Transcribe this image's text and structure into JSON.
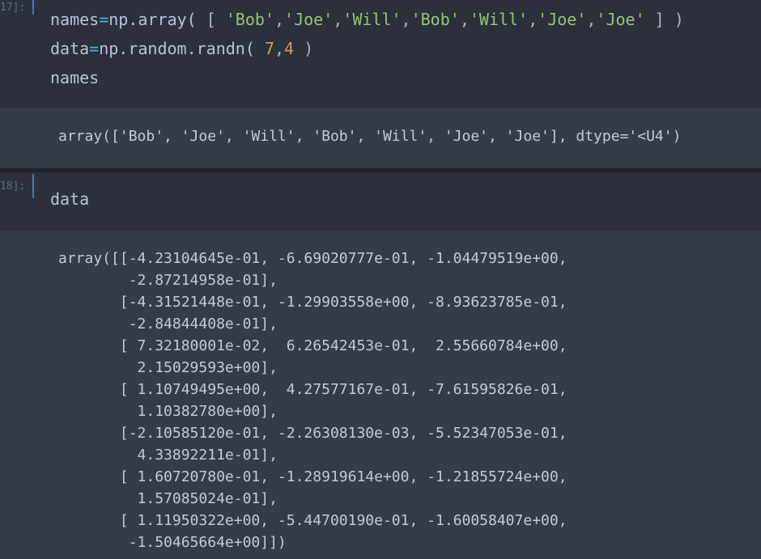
{
  "cells": [
    {
      "prompt": "17]:",
      "input": {
        "line1": {
          "var": "names",
          "op": "=",
          "call": "np.array(",
          "bracket_open": " [ ",
          "s1": "'Bob'",
          "c1": ",",
          "s2": "'Joe'",
          "c2": ",",
          "s3": "'Will'",
          "c3": ",",
          "s4": "'Bob'",
          "c4": ",",
          "s5": "'Will'",
          "c5": ",",
          "s6": "'Joe'",
          "c6": ",",
          "s7": "'Joe'",
          "bracket_close": " ] )"
        },
        "line2": {
          "var": "data",
          "op": "=",
          "call": "np.random.randn(",
          "n1": " 7",
          "comma": ",",
          "n2": "4",
          "close": " )"
        },
        "line3": "names"
      },
      "output": "array(['Bob', 'Joe', 'Will', 'Bob', 'Will', 'Joe', 'Joe'], dtype='<U4')"
    },
    {
      "prompt": "18]:",
      "input": {
        "line1": "data"
      },
      "output_lines": [
        "array([[-4.23104645e-01, -6.69020777e-01, -1.04479519e+00,",
        "        -2.87214958e-01],",
        "       [-4.31521448e-01, -1.29903558e+00, -8.93623785e-01,",
        "        -2.84844408e-01],",
        "       [ 7.32180001e-02,  6.26542453e-01,  2.55660784e+00,",
        "         2.15029593e+00],",
        "       [ 1.10749495e+00,  4.27577167e-01, -7.61595826e-01,",
        "         1.10382780e+00],",
        "       [-2.10585120e-01, -2.26308130e-03, -5.52347053e-01,",
        "         4.33892211e-01],",
        "       [ 1.60720780e-01, -1.28919614e+00, -1.21855724e+00,",
        "         1.57085024e-01],",
        "       [ 1.11950322e+00, -5.44700190e-01, -1.60058407e+00,",
        "        -1.50465664e+00]])"
      ]
    }
  ]
}
